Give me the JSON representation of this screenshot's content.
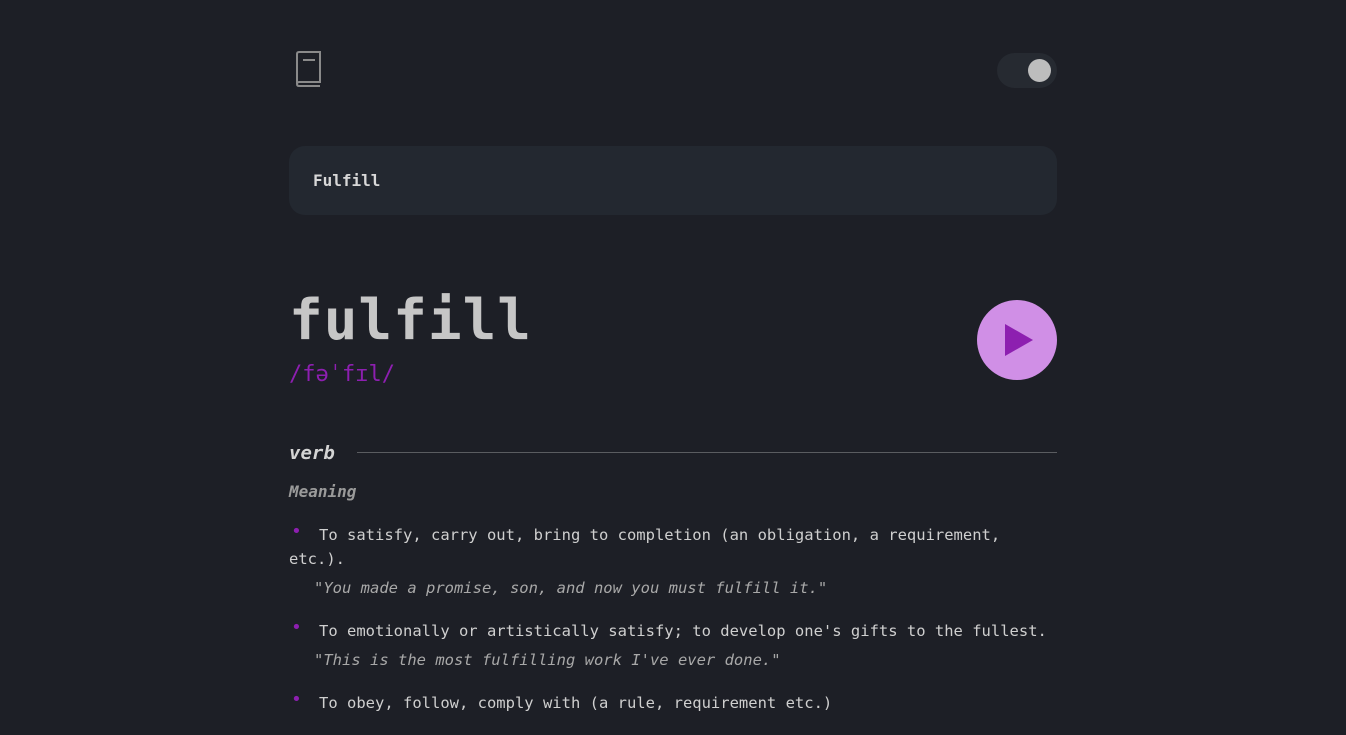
{
  "header": {
    "logo_icon": "book-icon",
    "theme_toggle": {
      "state": "dark",
      "knob_color": "#bdbdbd"
    }
  },
  "search": {
    "value": "Fulfill"
  },
  "entry": {
    "word": "fulfill",
    "phonetic": "/fəˈfɪl/",
    "play_icon": "play-icon",
    "accent_color": "#8d1fb0",
    "play_bg_color": "#d08fe6"
  },
  "meanings": [
    {
      "part_of_speech": "verb",
      "label": "Meaning",
      "definitions": [
        {
          "text": "To satisfy, carry out, bring to completion (an obligation, a requirement, etc.).",
          "example": "\"You made a promise, son, and now you must fulfill it.\""
        },
        {
          "text": "To emotionally or artistically satisfy; to develop one's gifts to the fullest.",
          "example": "\"This is the most fulfilling work I've ever done.\""
        },
        {
          "text": "To obey, follow, comply with (a rule, requirement etc.)",
          "example": ""
        }
      ]
    }
  ]
}
